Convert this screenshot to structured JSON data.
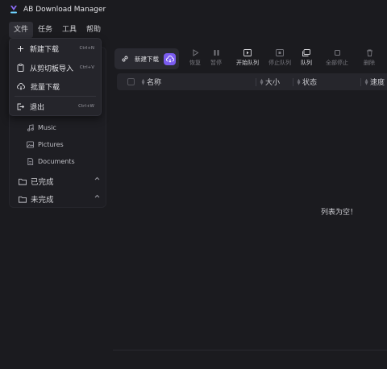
{
  "app": {
    "title": "AB Download Manager"
  },
  "menubar": {
    "items": [
      {
        "label": "文件",
        "active": true
      },
      {
        "label": "任务"
      },
      {
        "label": "工具"
      },
      {
        "label": "帮助"
      }
    ]
  },
  "file_menu": {
    "items": [
      {
        "label": "新建下载",
        "shortcut": "Ctrl+N",
        "icon": "plus-icon"
      },
      {
        "label": "从剪切板导入",
        "shortcut": "Ctrl+V",
        "icon": "clipboard-icon"
      },
      {
        "label": "批量下载",
        "shortcut": "",
        "icon": "cloud-download-icon"
      },
      {
        "label": "退出",
        "shortcut": "Ctrl+W",
        "icon": "exit-icon"
      }
    ]
  },
  "toolbar": {
    "new_download": "新建下载",
    "resume": "恢复",
    "pause": "暂停",
    "start_queue": "开始队列",
    "stop_queue": "停止队列",
    "queue": "队列",
    "stop_all": "全部停止",
    "delete": "删除"
  },
  "table": {
    "columns": [
      "名称",
      "大小",
      "状态",
      "速度"
    ],
    "empty_message": "列表为空！"
  },
  "sidebar": {
    "categories": [
      {
        "label": "Music",
        "icon": "music-icon"
      },
      {
        "label": "Pictures",
        "icon": "image-icon"
      },
      {
        "label": "Documents",
        "icon": "document-icon"
      }
    ],
    "groups": [
      {
        "label": "已完成",
        "icon": "folder-icon"
      },
      {
        "label": "未完成",
        "icon": "folder-icon"
      }
    ]
  },
  "colors": {
    "background": "#1b1b1f",
    "accent": "#7b5cf0",
    "menu_bg": "#25252b"
  }
}
